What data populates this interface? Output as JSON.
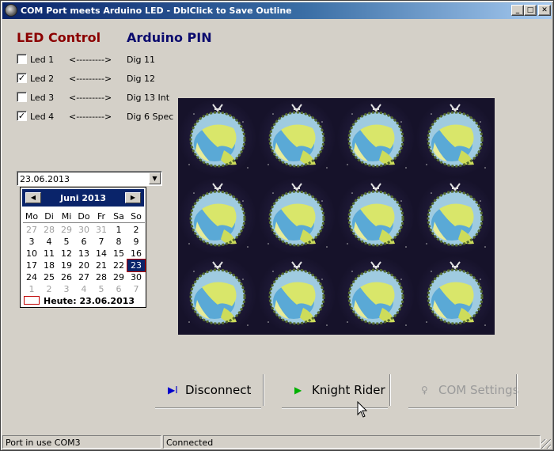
{
  "window": {
    "title": "COM Port meets Arduino LED - DblClick to Save Outline",
    "minimize": "_",
    "maximize": "□",
    "close": "✕"
  },
  "headings": {
    "led_control": "LED Control",
    "arduino_pin": "Arduino PIN"
  },
  "leds": [
    {
      "label": "Led 1",
      "checked": false,
      "mark": "",
      "arrow": "<--------->",
      "pin": "Dig 11"
    },
    {
      "label": "Led 2",
      "checked": true,
      "mark": "✓",
      "arrow": "<--------->",
      "pin": "Dig 12"
    },
    {
      "label": "Led 3",
      "checked": false,
      "mark": "",
      "arrow": "<--------->",
      "pin": "Dig 13 Int"
    },
    {
      "label": "Led 4",
      "checked": true,
      "mark": "✓",
      "arrow": "<--------->",
      "pin": "Dig 6 Spec"
    }
  ],
  "date_picker": {
    "value": "23.06.2013",
    "dropdown_icon": "▼",
    "month_title": "Juni 2013",
    "prev_icon": "◀",
    "next_icon": "▶",
    "weekdays": [
      "Mo",
      "Di",
      "Mi",
      "Do",
      "Fr",
      "Sa",
      "So"
    ],
    "weeks": [
      [
        "27",
        "28",
        "29",
        "30",
        "31",
        "1",
        "2"
      ],
      [
        "3",
        "4",
        "5",
        "6",
        "7",
        "8",
        "9"
      ],
      [
        "10",
        "11",
        "12",
        "13",
        "14",
        "15",
        "16"
      ],
      [
        "17",
        "18",
        "19",
        "20",
        "21",
        "22",
        "23"
      ],
      [
        "24",
        "25",
        "26",
        "27",
        "28",
        "29",
        "30"
      ],
      [
        "1",
        "2",
        "3",
        "4",
        "5",
        "6",
        "7"
      ]
    ],
    "selected_day": "23",
    "today_label": "Heute: 23.06.2013"
  },
  "image_grid": {
    "rows": 3,
    "cols": 4,
    "icon": "album-art-planet"
  },
  "buttons": {
    "disconnect": {
      "icon": "▶I",
      "label": "Disconnect",
      "enabled": true
    },
    "knight_rider": {
      "icon": "▶",
      "label": "Knight Rider",
      "enabled": true
    },
    "com_settings": {
      "icon": "♀",
      "label": "COM Settings",
      "enabled": false
    }
  },
  "status": {
    "port": "Port in use COM3",
    "connection": "Connected"
  },
  "colors": {
    "led_heading": "#8b0000",
    "pin_heading": "#0b0b6e",
    "title_bar": "#0a246a",
    "disconnect_icon": "#0000cc",
    "knight_icon": "#00b000",
    "today_outline": "#c00000"
  }
}
